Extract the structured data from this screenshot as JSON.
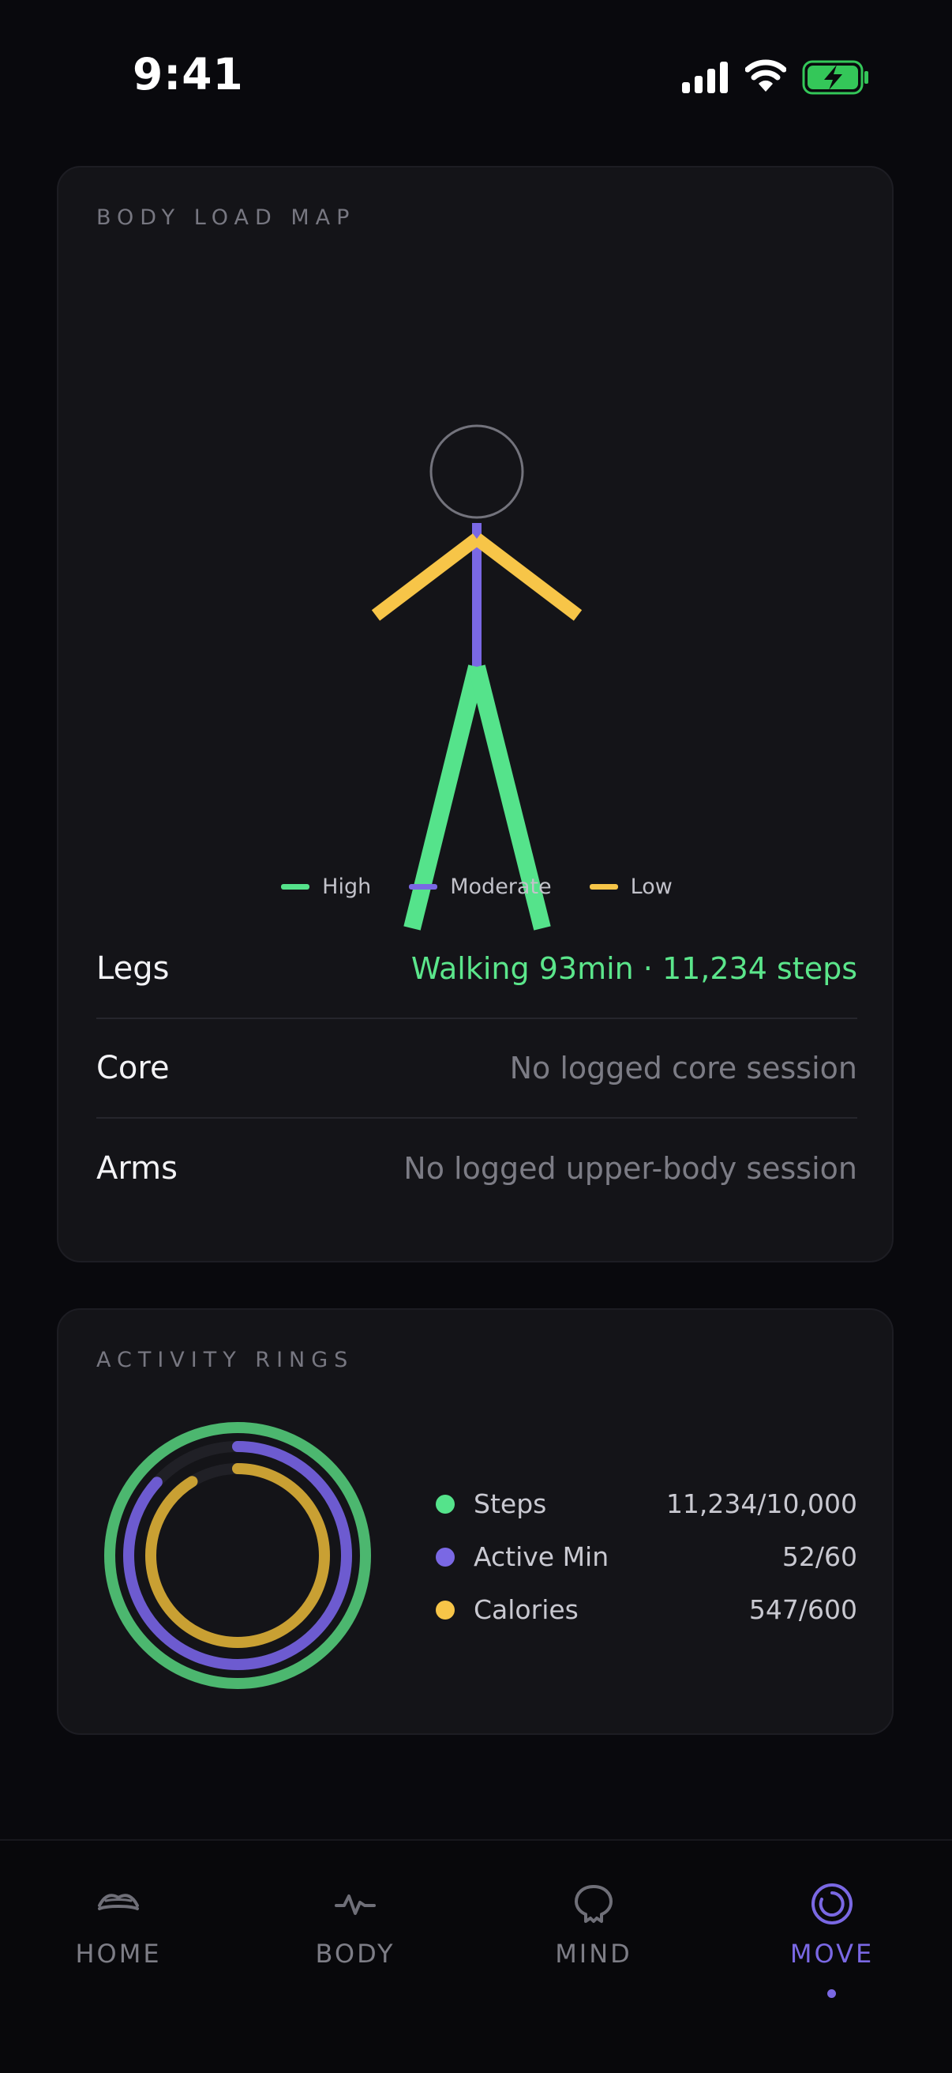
{
  "status_bar": {
    "time": "9:41"
  },
  "body_load_map": {
    "title": "BODY LOAD MAP",
    "legend": [
      {
        "label": "High",
        "color": "#55e38b"
      },
      {
        "label": "Moderate",
        "color": "#7a68e4"
      },
      {
        "label": "Low",
        "color": "#f7c548"
      }
    ],
    "figure_loads": {
      "legs": "High",
      "core": "Moderate",
      "arms": "Low"
    },
    "rows": [
      {
        "part": "Legs",
        "detail": "Walking 93min · 11,234 steps",
        "active": true
      },
      {
        "part": "Core",
        "detail": "No logged core session",
        "active": false
      },
      {
        "part": "Arms",
        "detail": "No logged upper-body session",
        "active": false
      }
    ]
  },
  "activity_rings": {
    "title": "ACTIVITY RINGS",
    "rings": [
      {
        "label": "Steps",
        "value": "11,234/10,000",
        "progress": 1.0,
        "color": "#4cb76f",
        "dot_color": "#55e38b"
      },
      {
        "label": "Active Min",
        "value": "52/60",
        "progress": 0.867,
        "color": "#6d5bd0",
        "dot_color": "#7a68e4"
      },
      {
        "label": "Calories",
        "value": "547/600",
        "progress": 0.912,
        "color": "#c9a033",
        "dot_color": "#f7c548"
      }
    ]
  },
  "tab_bar": {
    "tabs": [
      {
        "label": "HOME",
        "icon": "home-icon",
        "active": false
      },
      {
        "label": "BODY",
        "icon": "pulse-icon",
        "active": false
      },
      {
        "label": "MIND",
        "icon": "brain-icon",
        "active": false
      },
      {
        "label": "MOVE",
        "icon": "ring-icon",
        "active": true
      }
    ]
  }
}
